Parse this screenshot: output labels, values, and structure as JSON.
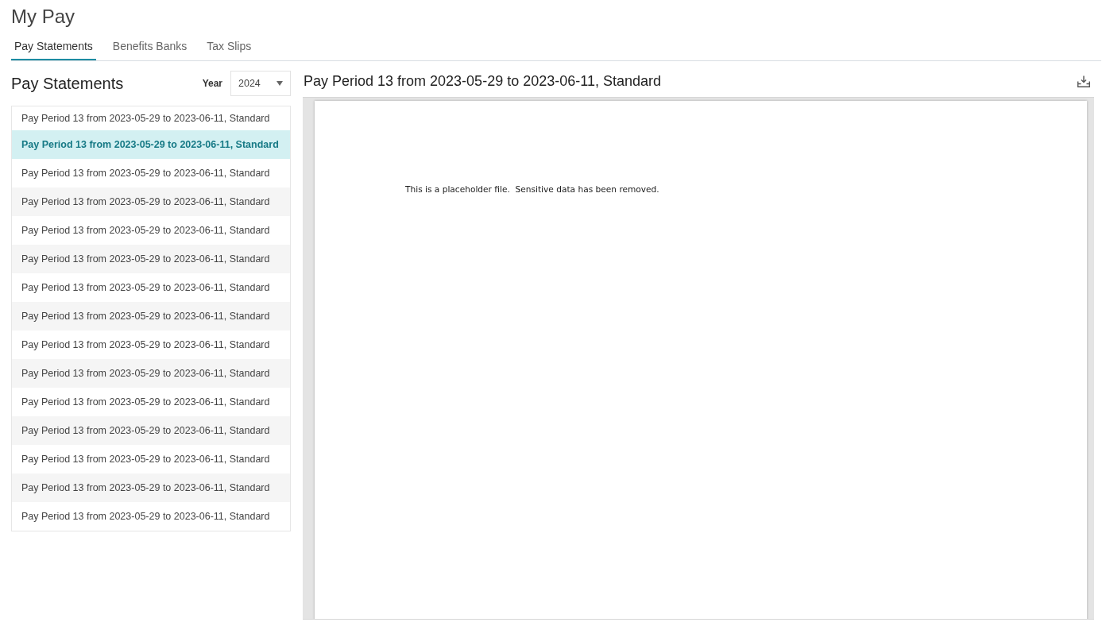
{
  "page": {
    "title": "My Pay"
  },
  "tabs": [
    {
      "label": "Pay Statements",
      "selected": true
    },
    {
      "label": "Benefits Banks",
      "selected": false
    },
    {
      "label": "Tax Slips",
      "selected": false
    }
  ],
  "statements": {
    "title": "Pay Statements",
    "year_label": "Year",
    "year_select": {
      "value": "2024"
    },
    "items": [
      {
        "label": "Pay Period 13 from 2023-05-29 to 2023-06-11, Standard",
        "selected": false
      },
      {
        "label": "Pay Period 13 from 2023-05-29 to 2023-06-11, Standard",
        "selected": true
      },
      {
        "label": "Pay Period 13 from 2023-05-29 to 2023-06-11, Standard",
        "selected": false
      },
      {
        "label": "Pay Period 13 from 2023-05-29 to 2023-06-11, Standard",
        "selected": false
      },
      {
        "label": "Pay Period 13 from 2023-05-29 to 2023-06-11, Standard",
        "selected": false
      },
      {
        "label": "Pay Period 13 from 2023-05-29 to 2023-06-11, Standard",
        "selected": false
      },
      {
        "label": "Pay Period 13 from 2023-05-29 to 2023-06-11, Standard",
        "selected": false
      },
      {
        "label": "Pay Period 13 from 2023-05-29 to 2023-06-11, Standard",
        "selected": false
      },
      {
        "label": "Pay Period 13 from 2023-05-29 to 2023-06-11, Standard",
        "selected": false
      },
      {
        "label": "Pay Period 13 from 2023-05-29 to 2023-06-11, Standard",
        "selected": false
      },
      {
        "label": "Pay Period 13 from 2023-05-29 to 2023-06-11, Standard",
        "selected": false
      },
      {
        "label": "Pay Period 13 from 2023-05-29 to 2023-06-11, Standard",
        "selected": false
      },
      {
        "label": "Pay Period 13 from 2023-05-29 to 2023-06-11, Standard",
        "selected": false
      },
      {
        "label": "Pay Period 13 from 2023-05-29 to 2023-06-11, Standard",
        "selected": false
      },
      {
        "label": "Pay Period 13 from 2023-05-29 to 2023-06-11, Standard",
        "selected": false
      }
    ]
  },
  "viewer": {
    "title": "Pay Period 13 from 2023-05-29 to 2023-06-11, Standard",
    "document_text": "This is a placeholder file.  Sensitive data has been removed."
  }
}
